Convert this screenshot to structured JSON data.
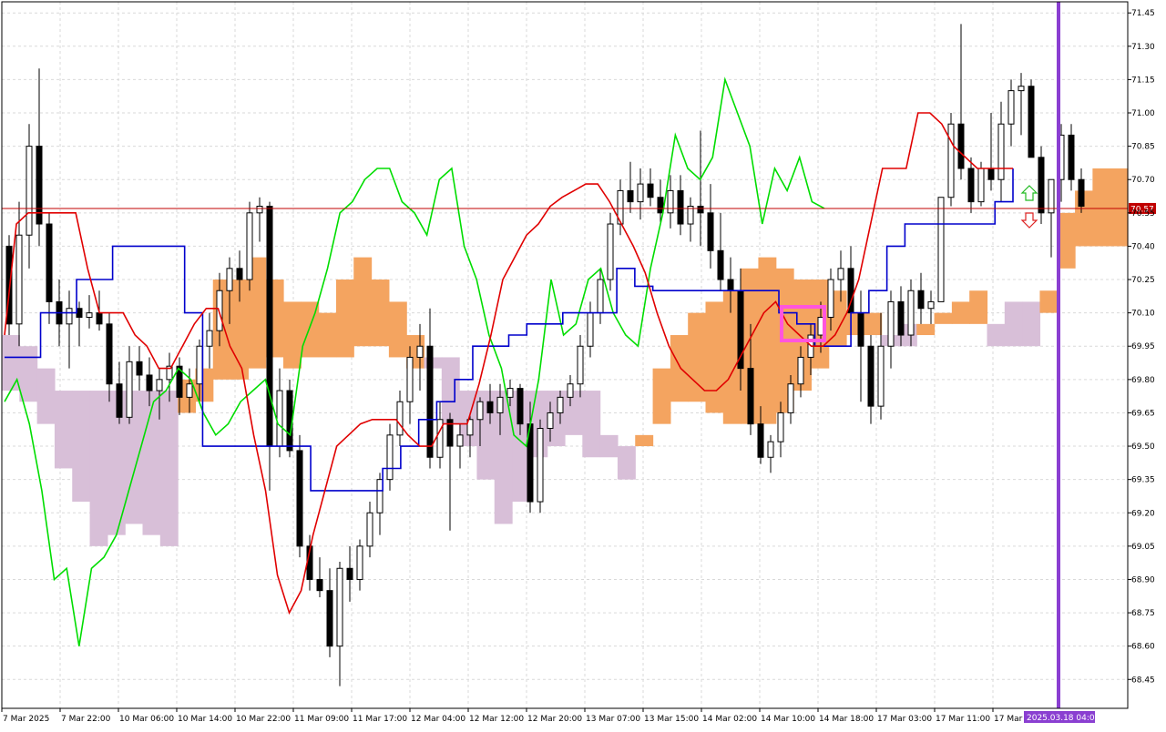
{
  "chart_data": {
    "type": "candlestick",
    "price_axis": {
      "ticks": [
        "71.45",
        "71.30",
        "71.15",
        "71.00",
        "70.85",
        "70.70",
        "70.55",
        "70.40",
        "70.25",
        "70.10",
        "69.95",
        "69.80",
        "69.65",
        "69.50",
        "69.35",
        "69.20",
        "69.05",
        "68.90",
        "68.75",
        "68.60",
        "68.45"
      ],
      "ylim": [
        68.32,
        71.5
      ]
    },
    "time_axis": {
      "labels": [
        "7 Mar 2025",
        "7 Mar 22:00",
        "10 Mar 06:00",
        "10 Mar 14:00",
        "10 Mar 22:00",
        "11 Mar 09:00",
        "11 Mar 17:00",
        "12 Mar 04:00",
        "12 Mar 12:00",
        "12 Mar 20:00",
        "13 Mar 07:00",
        "13 Mar 15:00",
        "14 Mar 02:00",
        "14 Mar 10:00",
        "14 Mar 18:00",
        "17 Mar 03:00",
        "17 Mar 11:00",
        "17 Mar"
      ],
      "cursor_label": "2025.03.18 04:00"
    },
    "current_price": {
      "value": 70.57,
      "label": "70.57"
    },
    "grid": true,
    "colors": {
      "price_line": "#c00000",
      "tenkan": "#e00000",
      "kijun": "#0000cc",
      "chikou": "#00dd00",
      "kumo_bull": "#f4a460",
      "kumo_bear": "#d8bfd8",
      "bull_candle": "#ffffff",
      "bear_candle": "#000000",
      "vline": "#8a3fd1",
      "highlight": "#ff55dd"
    },
    "candles": [
      [
        70.4,
        70.45,
        70.0,
        70.05
      ],
      [
        70.05,
        70.6,
        69.95,
        70.45
      ],
      [
        70.45,
        70.95,
        70.3,
        70.85
      ],
      [
        70.85,
        71.2,
        70.4,
        70.5
      ],
      [
        70.5,
        70.55,
        70.05,
        70.15
      ],
      [
        70.15,
        70.25,
        69.95,
        70.05
      ],
      [
        70.05,
        70.2,
        69.85,
        70.12
      ],
      [
        70.12,
        70.15,
        69.95,
        70.08
      ],
      [
        70.08,
        70.18,
        70.03,
        70.1
      ],
      [
        70.1,
        70.2,
        70.02,
        70.05
      ],
      [
        70.05,
        70.1,
        69.7,
        69.78
      ],
      [
        69.78,
        69.88,
        69.6,
        69.63
      ],
      [
        69.63,
        69.95,
        69.6,
        69.88
      ],
      [
        69.88,
        69.95,
        69.75,
        69.82
      ],
      [
        69.82,
        69.9,
        69.68,
        69.75
      ],
      [
        69.75,
        69.85,
        69.62,
        69.8
      ],
      [
        69.8,
        69.92,
        69.7,
        69.86
      ],
      [
        69.86,
        69.9,
        69.64,
        69.72
      ],
      [
        69.72,
        69.85,
        69.65,
        69.78
      ],
      [
        69.78,
        69.98,
        69.7,
        69.95
      ],
      [
        69.95,
        70.1,
        69.85,
        70.02
      ],
      [
        70.02,
        70.28,
        69.95,
        70.2
      ],
      [
        70.2,
        70.35,
        70.05,
        70.3
      ],
      [
        70.3,
        70.38,
        70.15,
        70.25
      ],
      [
        70.25,
        70.6,
        70.2,
        70.55
      ],
      [
        70.55,
        70.62,
        70.42,
        70.58
      ],
      [
        70.58,
        70.6,
        69.3,
        69.5
      ],
      [
        69.5,
        69.85,
        69.45,
        69.75
      ],
      [
        69.75,
        69.8,
        69.45,
        69.48
      ],
      [
        69.48,
        69.55,
        69.0,
        69.05
      ],
      [
        69.05,
        69.1,
        68.85,
        68.9
      ],
      [
        68.9,
        69.0,
        68.82,
        68.85
      ],
      [
        68.85,
        68.95,
        68.55,
        68.6
      ],
      [
        68.6,
        68.98,
        68.42,
        68.95
      ],
      [
        68.95,
        69.05,
        68.8,
        68.9
      ],
      [
        68.9,
        69.08,
        68.85,
        69.05
      ],
      [
        69.05,
        69.25,
        69.0,
        69.2
      ],
      [
        69.2,
        69.38,
        69.1,
        69.35
      ],
      [
        69.35,
        69.6,
        69.3,
        69.55
      ],
      [
        69.55,
        69.75,
        69.5,
        69.7
      ],
      [
        69.7,
        69.95,
        69.6,
        69.9
      ],
      [
        69.9,
        70.05,
        69.75,
        69.95
      ],
      [
        69.95,
        70.12,
        69.4,
        69.45
      ],
      [
        69.45,
        69.7,
        69.4,
        69.62
      ],
      [
        69.62,
        69.65,
        69.12,
        69.5
      ],
      [
        69.5,
        69.6,
        69.4,
        69.55
      ],
      [
        69.55,
        69.65,
        69.45,
        69.62
      ],
      [
        69.62,
        69.72,
        69.5,
        69.7
      ],
      [
        69.7,
        69.78,
        69.6,
        69.65
      ],
      [
        69.65,
        69.78,
        69.55,
        69.72
      ],
      [
        69.72,
        69.8,
        69.68,
        69.76
      ],
      [
        69.76,
        69.78,
        69.55,
        69.6
      ],
      [
        69.6,
        69.7,
        69.2,
        69.25
      ],
      [
        69.25,
        69.62,
        69.2,
        69.58
      ],
      [
        69.58,
        69.7,
        69.52,
        69.65
      ],
      [
        69.65,
        69.75,
        69.6,
        69.72
      ],
      [
        69.72,
        69.82,
        69.68,
        69.78
      ],
      [
        69.78,
        70.0,
        69.72,
        69.95
      ],
      [
        69.95,
        70.15,
        69.9,
        70.1
      ],
      [
        70.1,
        70.3,
        70.05,
        70.25
      ],
      [
        70.25,
        70.55,
        70.2,
        70.5
      ],
      [
        70.5,
        70.7,
        70.45,
        70.65
      ],
      [
        70.65,
        70.78,
        70.55,
        70.6
      ],
      [
        70.6,
        70.75,
        70.52,
        70.68
      ],
      [
        70.68,
        70.75,
        70.58,
        70.62
      ],
      [
        70.62,
        70.7,
        70.5,
        70.55
      ],
      [
        70.55,
        70.72,
        70.48,
        70.65
      ],
      [
        70.65,
        70.72,
        70.45,
        70.5
      ],
      [
        70.5,
        70.62,
        70.42,
        70.58
      ],
      [
        70.58,
        70.92,
        70.4,
        70.55
      ],
      [
        70.55,
        70.68,
        70.3,
        70.38
      ],
      [
        70.38,
        70.55,
        70.2,
        70.25
      ],
      [
        70.25,
        70.35,
        70.1,
        70.2
      ],
      [
        70.2,
        70.3,
        69.75,
        69.85
      ],
      [
        69.85,
        70.05,
        69.55,
        69.6
      ],
      [
        69.6,
        69.68,
        69.42,
        69.45
      ],
      [
        69.45,
        69.55,
        69.38,
        69.52
      ],
      [
        69.52,
        69.7,
        69.45,
        69.65
      ],
      [
        69.65,
        69.82,
        69.6,
        69.78
      ],
      [
        69.78,
        69.95,
        69.72,
        69.9
      ],
      [
        69.9,
        70.05,
        69.82,
        70.0
      ],
      [
        70.0,
        70.15,
        69.92,
        70.08
      ],
      [
        70.08,
        70.3,
        70.02,
        70.25
      ],
      [
        70.25,
        70.38,
        70.15,
        70.3
      ],
      [
        70.3,
        70.4,
        70.0,
        70.1
      ],
      [
        70.1,
        70.2,
        69.7,
        69.95
      ],
      [
        69.95,
        70.0,
        69.6,
        69.68
      ],
      [
        69.68,
        70.1,
        69.62,
        69.95
      ],
      [
        69.95,
        70.2,
        69.85,
        70.15
      ],
      [
        70.15,
        70.22,
        69.95,
        70.0
      ],
      [
        70.0,
        70.25,
        69.95,
        70.2
      ],
      [
        70.2,
        70.28,
        70.05,
        70.12
      ],
      [
        70.12,
        70.2,
        70.05,
        70.15
      ],
      [
        70.15,
        70.62,
        70.6,
        70.62
      ],
      [
        70.62,
        71.0,
        70.58,
        70.95
      ],
      [
        70.95,
        71.4,
        70.7,
        70.75
      ],
      [
        70.75,
        70.8,
        70.55,
        70.6
      ],
      [
        70.6,
        70.78,
        70.58,
        70.75
      ],
      [
        70.75,
        71.0,
        70.65,
        70.7
      ],
      [
        70.7,
        71.05,
        70.6,
        70.95
      ],
      [
        70.95,
        71.15,
        70.85,
        71.1
      ],
      [
        71.1,
        71.18,
        70.9,
        71.12
      ],
      [
        71.12,
        71.15,
        70.85,
        70.8
      ],
      [
        70.8,
        70.85,
        70.5,
        70.55
      ],
      [
        70.55,
        70.65,
        70.35,
        70.7
      ],
      [
        70.7,
        70.95,
        70.6,
        70.9
      ],
      [
        70.9,
        70.95,
        70.65,
        70.7
      ],
      [
        70.7,
        70.75,
        70.55,
        70.58
      ]
    ],
    "tenkan": [
      70.0,
      70.5,
      70.55,
      70.55,
      70.55,
      70.55,
      70.55,
      70.3,
      70.1,
      70.1,
      70.1,
      70.0,
      69.95,
      69.85,
      69.85,
      69.95,
      70.05,
      70.12,
      70.12,
      69.95,
      69.85,
      69.55,
      69.3,
      68.92,
      68.75,
      68.85,
      69.1,
      69.3,
      69.5,
      69.55,
      69.6,
      69.62,
      69.62,
      69.62,
      69.55,
      69.5,
      69.5,
      69.6,
      69.6,
      69.6,
      69.78,
      70.0,
      70.25,
      70.35,
      70.45,
      70.5,
      70.58,
      70.62,
      70.65,
      70.68,
      70.68,
      70.6,
      70.5,
      70.4,
      70.28,
      70.1,
      69.95,
      69.85,
      69.8,
      69.75,
      69.75,
      69.8,
      69.9,
      70.0,
      70.1,
      70.15,
      70.05,
      70.0,
      69.95,
      69.95,
      70.0,
      70.1,
      70.25,
      70.5,
      70.75,
      70.75,
      70.75,
      71.0,
      71.0,
      70.95,
      70.85,
      70.8,
      70.75,
      70.75,
      70.75,
      70.75
    ],
    "kijun": [
      69.9,
      69.9,
      70.1,
      70.1,
      70.25,
      70.25,
      70.4,
      70.4,
      70.4,
      70.4,
      70.1,
      69.5,
      69.5,
      69.5,
      69.5,
      69.5,
      69.5,
      69.3,
      69.3,
      69.3,
      69.3,
      69.4,
      69.5,
      69.62,
      69.7,
      69.8,
      69.95,
      69.95,
      70.0,
      70.05,
      70.05,
      70.1,
      70.1,
      70.1,
      70.3,
      70.22,
      70.2,
      70.2,
      70.2,
      70.2,
      70.2,
      70.2,
      70.2,
      70.1,
      70.05,
      69.95,
      69.95,
      70.1,
      70.2,
      70.4,
      70.5,
      70.5,
      70.5,
      70.5,
      70.5,
      70.6,
      70.75
    ],
    "chikou": [
      69.7,
      69.8,
      69.6,
      69.3,
      68.9,
      68.95,
      68.6,
      68.95,
      69.0,
      69.1,
      69.3,
      69.5,
      69.7,
      69.75,
      69.85,
      69.8,
      69.65,
      69.55,
      69.6,
      69.7,
      69.75,
      69.8,
      69.6,
      69.55,
      69.95,
      70.1,
      70.3,
      70.55,
      70.6,
      70.7,
      70.75,
      70.75,
      70.6,
      70.55,
      70.45,
      70.7,
      70.75,
      70.4,
      70.25,
      70.0,
      69.85,
      69.55,
      69.5,
      69.8,
      70.25,
      70.0,
      70.05,
      70.25,
      70.3,
      70.1,
      70.0,
      69.95,
      70.3,
      70.55,
      70.9,
      70.75,
      70.7,
      70.8,
      71.15,
      71.0,
      70.85,
      70.5,
      70.75,
      70.65,
      70.8,
      70.6,
      70.57
    ],
    "kumo": [
      [
        69.75,
        70.0,
        0
      ],
      [
        69.7,
        69.95,
        0
      ],
      [
        69.6,
        69.85,
        0
      ],
      [
        69.4,
        69.75,
        0
      ],
      [
        69.25,
        69.75,
        0
      ],
      [
        69.05,
        69.75,
        0
      ],
      [
        69.1,
        69.75,
        0
      ],
      [
        69.15,
        69.75,
        0
      ],
      [
        69.1,
        69.75,
        0
      ],
      [
        69.05,
        69.75,
        0
      ],
      [
        69.65,
        69.8,
        1
      ],
      [
        69.7,
        69.85,
        1
      ],
      [
        69.8,
        70.25,
        1
      ],
      [
        69.8,
        70.25,
        1
      ],
      [
        69.85,
        70.35,
        1
      ],
      [
        69.9,
        70.25,
        1
      ],
      [
        69.85,
        70.15,
        1
      ],
      [
        69.9,
        70.15,
        1
      ],
      [
        69.9,
        70.1,
        1
      ],
      [
        69.9,
        70.25,
        1
      ],
      [
        69.95,
        70.35,
        1
      ],
      [
        69.95,
        70.25,
        1
      ],
      [
        69.9,
        70.15,
        1
      ],
      [
        69.85,
        70.0,
        1
      ],
      [
        69.85,
        69.9,
        0
      ],
      [
        69.6,
        69.9,
        0
      ],
      [
        69.5,
        69.75,
        0
      ],
      [
        69.35,
        69.75,
        0
      ],
      [
        69.15,
        69.75,
        0
      ],
      [
        69.25,
        69.75,
        0
      ],
      [
        69.45,
        69.75,
        0
      ],
      [
        69.5,
        69.75,
        0
      ],
      [
        69.55,
        69.75,
        0
      ],
      [
        69.45,
        69.75,
        0
      ],
      [
        69.45,
        69.55,
        0
      ],
      [
        69.35,
        69.5,
        0
      ],
      [
        69.5,
        69.55,
        1
      ],
      [
        69.6,
        69.85,
        1
      ],
      [
        69.7,
        70.0,
        1
      ],
      [
        69.7,
        70.1,
        1
      ],
      [
        69.65,
        70.15,
        1
      ],
      [
        69.6,
        70.2,
        1
      ],
      [
        69.6,
        70.3,
        1
      ],
      [
        69.6,
        70.35,
        1
      ],
      [
        69.65,
        70.3,
        1
      ],
      [
        69.75,
        70.25,
        1
      ],
      [
        69.85,
        70.25,
        1
      ],
      [
        69.95,
        70.2,
        1
      ],
      [
        70.0,
        70.1,
        1
      ],
      [
        70.0,
        70.1,
        1
      ],
      [
        69.95,
        70.0,
        0
      ],
      [
        69.95,
        70.05,
        0
      ],
      [
        70.0,
        70.05,
        1
      ],
      [
        70.05,
        70.1,
        1
      ],
      [
        70.05,
        70.15,
        1
      ],
      [
        70.05,
        70.2,
        1
      ],
      [
        69.95,
        70.05,
        0
      ],
      [
        69.95,
        70.15,
        0
      ],
      [
        69.95,
        70.15,
        0
      ],
      [
        70.1,
        70.2,
        1
      ],
      [
        70.3,
        70.55,
        1
      ],
      [
        70.4,
        70.65,
        1
      ],
      [
        70.4,
        70.75,
        1
      ],
      [
        70.4,
        70.75,
        1
      ]
    ]
  }
}
